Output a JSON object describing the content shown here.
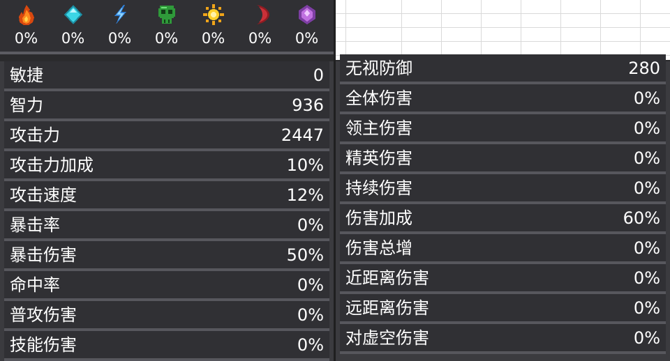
{
  "resistances": [
    {
      "icon": "fire-icon",
      "color": "#ff7a1a",
      "value": "0%"
    },
    {
      "icon": "ice-crystal-icon",
      "color": "#3cd6e6",
      "value": "0%"
    },
    {
      "icon": "lightning-icon",
      "color": "#56b8ff",
      "value": "0%"
    },
    {
      "icon": "poison-skull-icon",
      "color": "#3fbf4a",
      "value": "0%"
    },
    {
      "icon": "sun-icon",
      "color": "#ffcf2a",
      "value": "0%"
    },
    {
      "icon": "crescent-moon-icon",
      "color": "#b3262d",
      "value": "0%"
    },
    {
      "icon": "void-crystal-icon",
      "color": "#c070e0",
      "value": "0%"
    }
  ],
  "left_stats": [
    {
      "label": "敏捷",
      "value": "0"
    },
    {
      "label": "智力",
      "value": "936"
    },
    {
      "label": "攻击力",
      "value": "2447"
    },
    {
      "label": "攻击力加成",
      "value": "10%"
    },
    {
      "label": "攻击速度",
      "value": "12%"
    },
    {
      "label": "暴击率",
      "value": "0%"
    },
    {
      "label": "暴击伤害",
      "value": "50%"
    },
    {
      "label": "命中率",
      "value": "0%"
    },
    {
      "label": "普攻伤害",
      "value": "0%"
    },
    {
      "label": "技能伤害",
      "value": "0%"
    }
  ],
  "right_stats": [
    {
      "label": "无视防御",
      "value": "280"
    },
    {
      "label": "全体伤害",
      "value": "0%"
    },
    {
      "label": "领主伤害",
      "value": "0%"
    },
    {
      "label": "精英伤害",
      "value": "0%"
    },
    {
      "label": "持续伤害",
      "value": "0%"
    },
    {
      "label": "伤害加成",
      "value": "60%"
    },
    {
      "label": "伤害总增",
      "value": "0%"
    },
    {
      "label": "近距离伤害",
      "value": "0%"
    },
    {
      "label": "远距离伤害",
      "value": "0%"
    },
    {
      "label": "对虚空伤害",
      "value": "0%"
    }
  ]
}
